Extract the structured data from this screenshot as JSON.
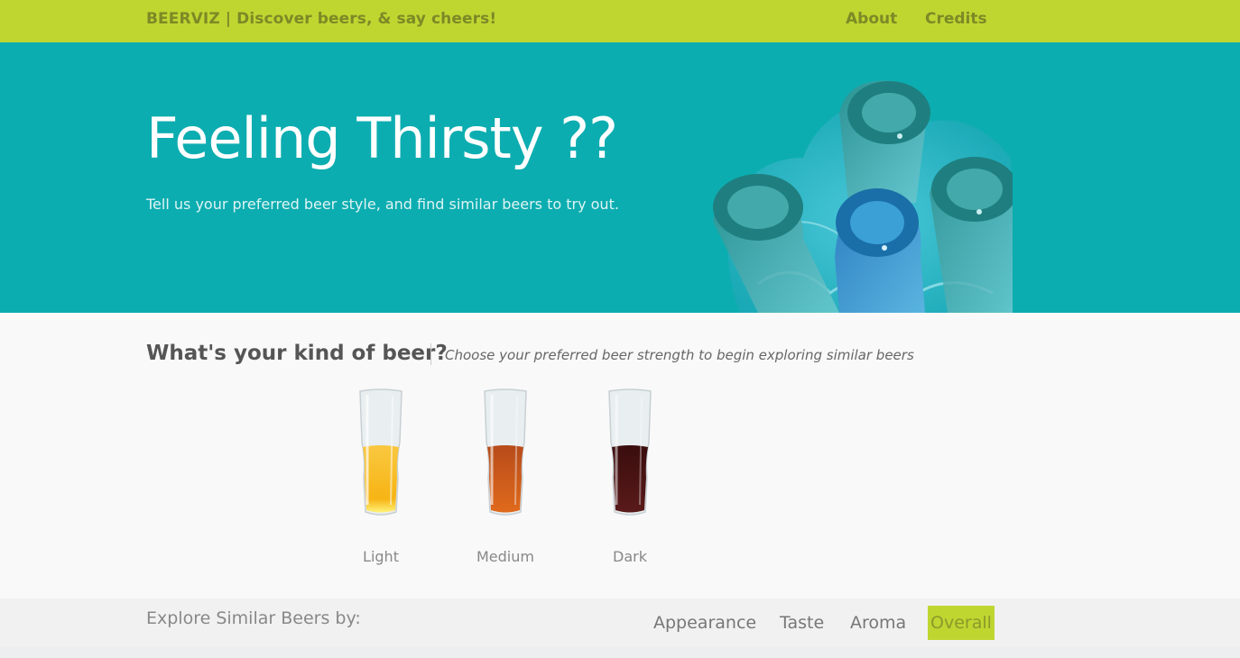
{
  "navbar": {
    "brand": "BEERVIZ | Discover beers, & say cheers!",
    "links": [
      {
        "label": "About"
      },
      {
        "label": "Credits"
      }
    ]
  },
  "hero": {
    "title": "Feeling Thirsty ??",
    "subtitle": "Tell us your preferred beer style, and find similar beers to try out."
  },
  "beer_selector": {
    "title": "What's your kind of beer?",
    "hint": "Choose your preferred beer strength to begin exploring similar beers",
    "options": [
      {
        "label": "Light",
        "color": "#f5b31a"
      },
      {
        "label": "Medium",
        "color": "#c2531a"
      },
      {
        "label": "Dark",
        "color": "#4a1212"
      }
    ]
  },
  "explore": {
    "label": "Explore Similar Beers by:",
    "tabs": [
      {
        "label": "Appearance",
        "active": false
      },
      {
        "label": "Taste",
        "active": false
      },
      {
        "label": "Aroma",
        "active": false
      },
      {
        "label": "Overall",
        "active": true
      }
    ]
  },
  "colors": {
    "navbar": "#bfd631",
    "hero": "#0cadb0",
    "active_tab": "#bfd631"
  }
}
